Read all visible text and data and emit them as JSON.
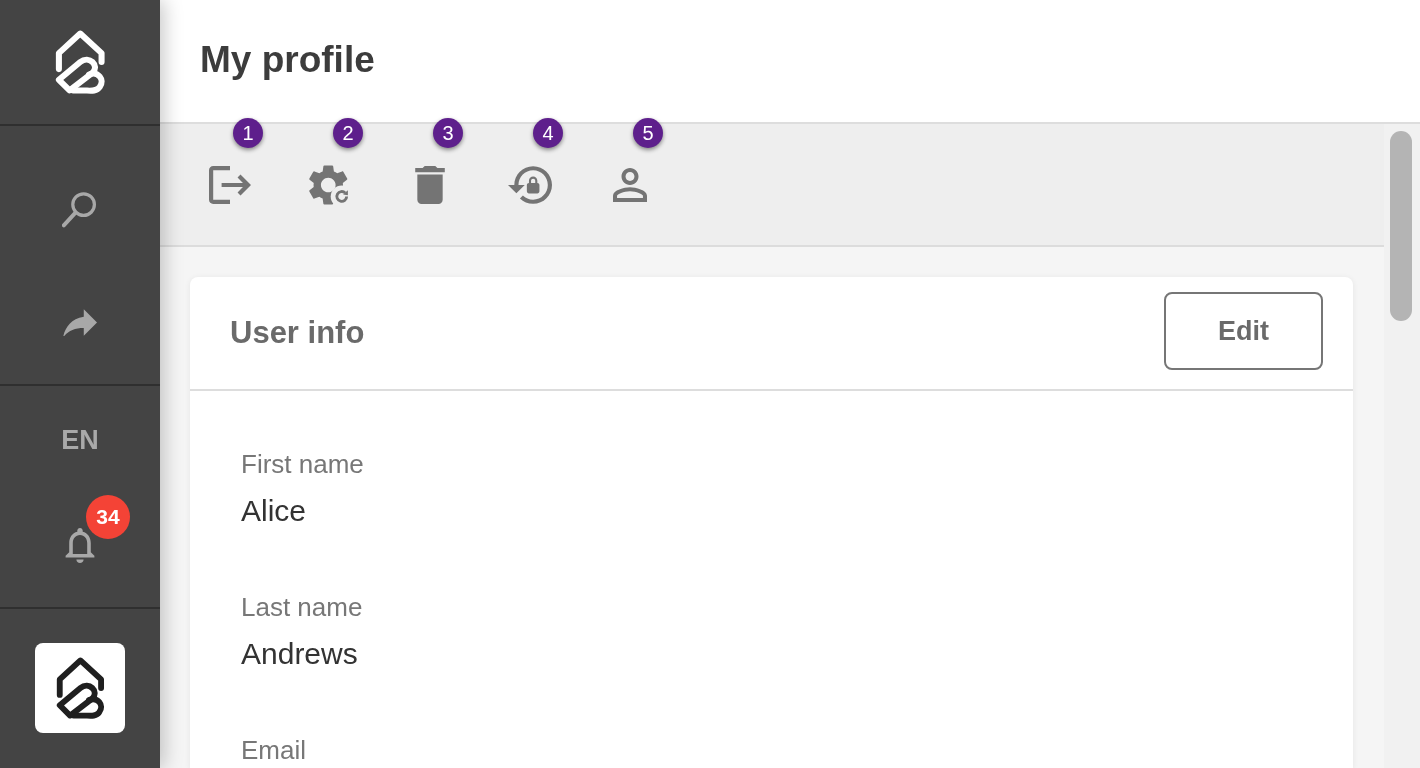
{
  "sidebar": {
    "items": [
      {
        "kind": "search"
      },
      {
        "kind": "share"
      }
    ],
    "language": "EN",
    "notifications": {
      "count": "34"
    }
  },
  "header": {
    "title": "My profile"
  },
  "toolbar": [
    {
      "kind": "logout",
      "number": "1"
    },
    {
      "kind": "settings-refresh",
      "number": "2"
    },
    {
      "kind": "delete",
      "number": "3"
    },
    {
      "kind": "lock-reset",
      "number": "4"
    },
    {
      "kind": "person",
      "number": "5"
    }
  ],
  "card": {
    "title": "User info",
    "button": "Edit",
    "fields": [
      {
        "label": "First name",
        "value": "Alice"
      },
      {
        "label": "Last name",
        "value": "Andrews"
      },
      {
        "label": "Email"
      }
    ]
  }
}
